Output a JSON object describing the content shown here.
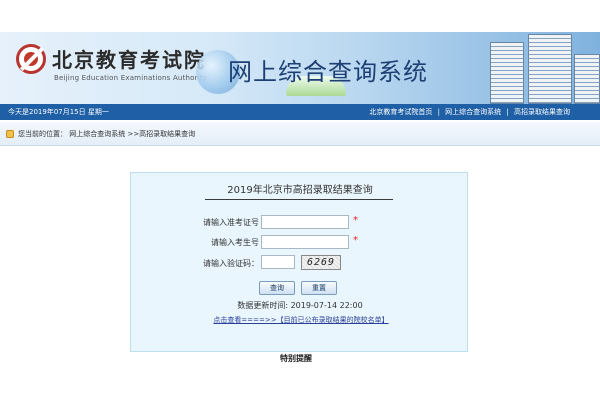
{
  "header": {
    "org_name_cn": "北京教育考试院",
    "org_name_en": "Beijing Education Examinations Authority",
    "system_title": "网上综合查询系统"
  },
  "infobar": {
    "today": "今天是2019年07月15日  星期一",
    "links": [
      "北京教育考试院首页",
      "网上综合查询系统",
      "高招录取结果查询"
    ],
    "separator": "|"
  },
  "breadcrumb": {
    "text": "您当前的位置： 网上综合查询系统 >>高招录取结果查询"
  },
  "form": {
    "title": "2019年北京市高招录取结果查询",
    "exam_id_label": "请输入准考证号",
    "student_id_label": "请输入考生号",
    "captcha_label": "请输入验证码：",
    "exam_id_value": "",
    "student_id_value": "",
    "captcha_value": "",
    "captcha_image_text": "6269",
    "required_mark": "*",
    "query_button": "查询",
    "reset_button": "重置",
    "update_time": "数据更新时间:  2019-07-14 22:00",
    "notice_link": "点击查看====>>【目前已公布录取结果的院校名单】"
  },
  "footer": {
    "special_note": "特别提醒"
  },
  "colors": {
    "infobar_bg": "#1f5fa6",
    "panel_bg": "#eaf6fd",
    "title_color": "#1e3f73"
  }
}
